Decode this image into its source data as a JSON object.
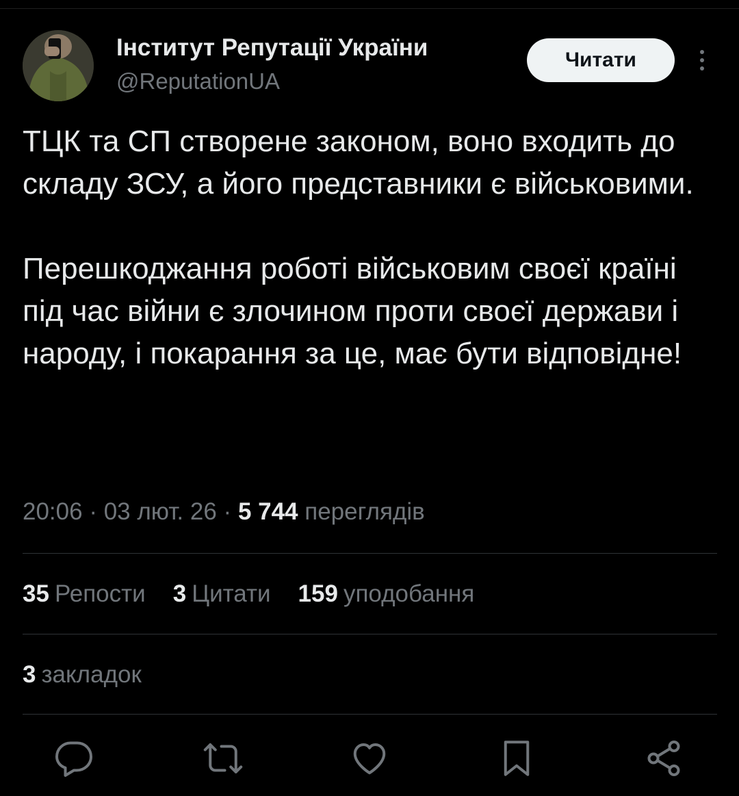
{
  "tweet": {
    "author_name": "Інститут Репутації України",
    "author_handle": "@ReputationUA",
    "follow_label": "Читати",
    "paragraphs": [
      "ТЦК та СП створене законом, воно входить до складу ЗСУ, а його представники є військовими.",
      "Перешкоджання роботі військовим своєї країні під час війни є злочином проти своєї держави і народу, і покарання за це, має бути відповідне!"
    ],
    "time": "20:06",
    "date": "03 лют. 26",
    "views_count": "5 744",
    "views_label": "переглядів",
    "separator": "·"
  },
  "stats": {
    "reposts": {
      "count": "35",
      "label": "Репости"
    },
    "quotes": {
      "count": "3",
      "label": "Цитати"
    },
    "likes": {
      "count": "159",
      "label": "уподобання"
    },
    "bookmarks": {
      "count": "3",
      "label": "закладок"
    }
  },
  "actions": {
    "icons": [
      "reply-icon",
      "repost-icon",
      "like-icon",
      "bookmark-icon",
      "share-icon"
    ]
  },
  "colors": {
    "background": "#000000",
    "text_primary": "#e7e9ea",
    "text_secondary": "#71767b",
    "divider": "#2f3336",
    "button_bg": "#eff3f4"
  }
}
